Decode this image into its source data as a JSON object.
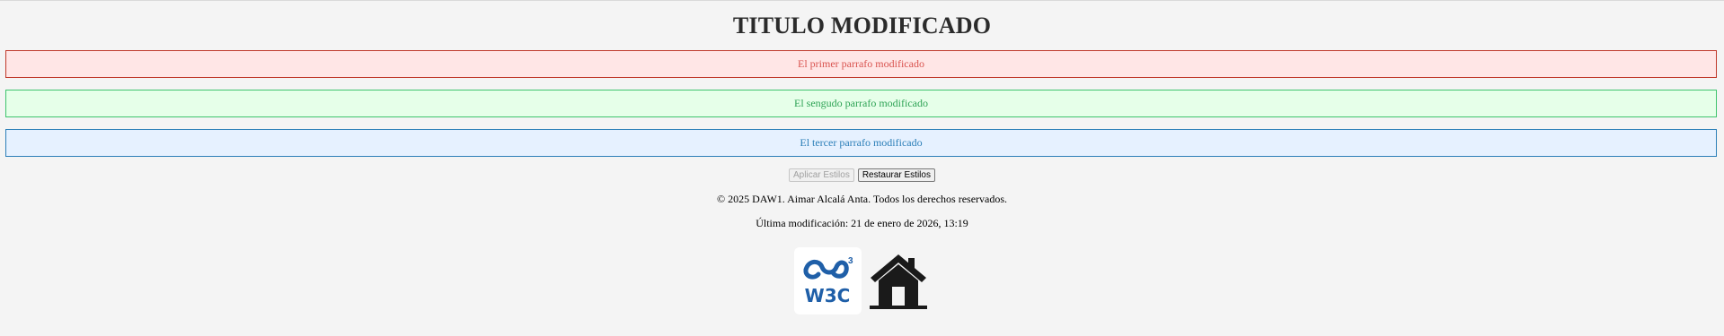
{
  "page": {
    "title": "TITULO MODIFICADO"
  },
  "paragraphs": [
    {
      "text": "El primer parrafo modificado"
    },
    {
      "text": "El sengudo parrafo modificado"
    },
    {
      "text": "El tercer parrafo modificado"
    }
  ],
  "buttons": {
    "apply_label": "Aplicar Estilos",
    "restore_label": "Restaurar Estilos"
  },
  "footer": {
    "copyright": "© 2025 DAW1. Aimar Alcalá Anta. Todos los derechos reservados.",
    "last_modified": "Última modificación: 21 de enero de 2026, 13:19"
  },
  "logos": {
    "w3c_text": "W3C",
    "w3c_icon": "w3c-logo",
    "home_icon": "home-icon"
  },
  "colors": {
    "paragraph1_bg": "#ffe6e6",
    "paragraph1_text": "#d9534f",
    "paragraph2_bg": "#e6ffe9",
    "paragraph2_text": "#2ea355",
    "paragraph3_bg": "#e6f1ff",
    "paragraph3_text": "#2c7fb8",
    "w3c_blue": "#1f5fa8"
  }
}
